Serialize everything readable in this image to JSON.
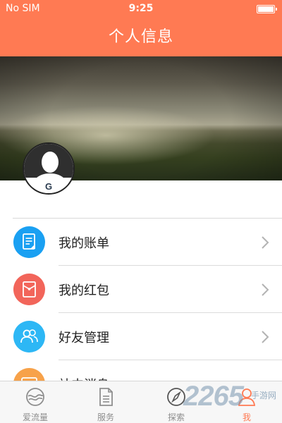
{
  "status_bar": {
    "carrier": "No SIM",
    "time": "9:25"
  },
  "header": {
    "title": "个人信息"
  },
  "profile": {
    "avatar_letter": "G"
  },
  "menu": {
    "items": [
      {
        "label": "我的账单",
        "icon": "bill-icon",
        "color": "#1aa0f2"
      },
      {
        "label": "我的红包",
        "icon": "red-envelope-icon",
        "color": "#f2655a"
      },
      {
        "label": "好友管理",
        "icon": "friends-icon",
        "color": "#2db7f5"
      },
      {
        "label": "站内消息",
        "icon": "message-icon",
        "color": "#f7a24a"
      }
    ]
  },
  "tabbar": {
    "tabs": [
      {
        "label": "爱流量",
        "icon": "data-flow-icon"
      },
      {
        "label": "服务",
        "icon": "document-icon"
      },
      {
        "label": "探索",
        "icon": "compass-icon"
      },
      {
        "label": "我",
        "icon": "user-icon",
        "active": true
      }
    ]
  },
  "watermark": {
    "brand": "2265",
    "suffix": "手游网"
  },
  "colors": {
    "accent": "#ff7a53"
  }
}
